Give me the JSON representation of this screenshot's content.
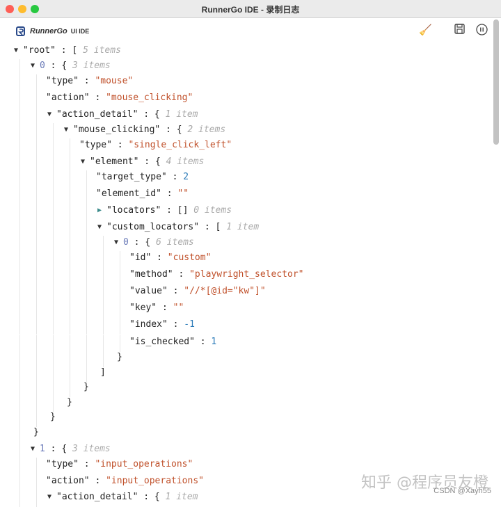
{
  "window": {
    "title": "RunnerGo IDE - 录制日志"
  },
  "header": {
    "logo_text": "RunnerGo",
    "logo_sub": "UI IDE",
    "icons": [
      "broom-icon",
      "save-icon",
      "pause-icon"
    ]
  },
  "colors": {
    "string": "#c0502a",
    "number": "#2a7ab8",
    "meta": "#aaaaaa"
  },
  "rows": [
    {
      "level": 0,
      "toggle": "open",
      "key": "\"root\"",
      "open": "[",
      "meta": "5 items"
    },
    {
      "level": 1,
      "toggle": "open",
      "idx": "0",
      "open": "{",
      "meta": "3 items"
    },
    {
      "level": 2,
      "key": "\"type\"",
      "str": "\"mouse\""
    },
    {
      "level": 2,
      "key": "\"action\"",
      "str": "\"mouse_clicking\""
    },
    {
      "level": 2,
      "toggle": "open",
      "key": "\"action_detail\"",
      "open": "{",
      "meta": "1 item"
    },
    {
      "level": 3,
      "toggle": "open",
      "key": "\"mouse_clicking\"",
      "open": "{",
      "meta": "2 items"
    },
    {
      "level": 4,
      "key": "\"type\"",
      "str": "\"single_click_left\""
    },
    {
      "level": 4,
      "toggle": "open",
      "key": "\"element\"",
      "open": "{",
      "meta": "4 items"
    },
    {
      "level": 5,
      "key": "\"target_type\"",
      "num": "2"
    },
    {
      "level": 5,
      "key": "\"element_id\"",
      "str": "\"\""
    },
    {
      "level": 5,
      "toggle": "closed",
      "key": "\"locators\"",
      "open": "[]",
      "meta": "0 items"
    },
    {
      "level": 5,
      "toggle": "open",
      "key": "\"custom_locators\"",
      "open": "[",
      "meta": "1 item"
    },
    {
      "level": 6,
      "toggle": "open",
      "idx": "0",
      "open": "{",
      "meta": "6 items"
    },
    {
      "level": 7,
      "key": "\"id\"",
      "str": "\"custom\""
    },
    {
      "level": 7,
      "key": "\"method\"",
      "str": "\"playwright_selector\""
    },
    {
      "level": 7,
      "key": "\"value\"",
      "str": "\"//*[@id=\"kw\"]\""
    },
    {
      "level": 7,
      "key": "\"key\"",
      "str": "\"\""
    },
    {
      "level": 7,
      "key": "\"index\"",
      "num": "-1"
    },
    {
      "level": 7,
      "key": "\"is_checked\"",
      "num": "1"
    },
    {
      "level": 6,
      "close": "}"
    },
    {
      "level": 5,
      "close": "]"
    },
    {
      "level": 4,
      "close": "}"
    },
    {
      "level": 3,
      "close": "}"
    },
    {
      "level": 2,
      "close": "}"
    },
    {
      "level": 1,
      "close": "}"
    },
    {
      "level": 1,
      "toggle": "open",
      "idx": "1",
      "open": "{",
      "meta": "3 items"
    },
    {
      "level": 2,
      "key": "\"type\"",
      "str": "\"input_operations\""
    },
    {
      "level": 2,
      "key": "\"action\"",
      "str": "\"input_operations\""
    },
    {
      "level": 2,
      "toggle": "open",
      "key": "\"action_detail\"",
      "open": "{",
      "meta": "1 item"
    }
  ],
  "watermark": {
    "zhihu": "知乎 @程序员友橙",
    "csdn": "CSDN @Xayh55"
  }
}
